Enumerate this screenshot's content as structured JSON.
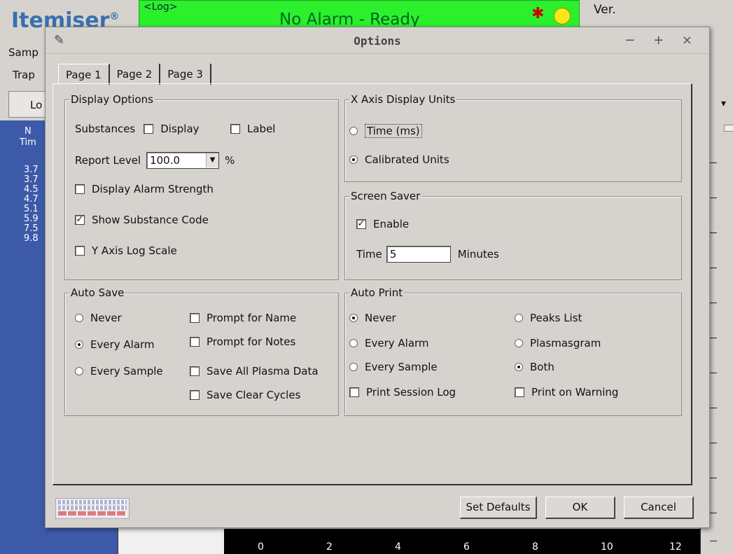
{
  "app": {
    "logo": "Itemiser",
    "logo_mark": "®",
    "status_log": "<Log>",
    "status_text": "No Alarm - Ready",
    "version_label": "Ver.",
    "bg_sample_label": "Samp",
    "bg_trap_label": "Trap",
    "bg_button_label": "Lo",
    "left_panel_header": "N\nTim",
    "left_panel_values": [
      "3.7",
      "3.7",
      "4.5",
      "4.7",
      "5.1",
      "5.9",
      "7.5",
      "9.8"
    ],
    "axis_ticks": [
      "0",
      "2",
      "4",
      "6",
      "8",
      "10",
      "12"
    ],
    "colors": {
      "status_bg": "#2cf02c",
      "panel_bg": "#3d5aa8",
      "logo": "#3a6fb0"
    }
  },
  "dialog": {
    "title": "Options",
    "title_buttons": "− + ×",
    "tabs": [
      {
        "label": "Page 1",
        "active": true
      },
      {
        "label": "Page 2",
        "active": false
      },
      {
        "label": "Page 3",
        "active": false
      }
    ],
    "display_options": {
      "title": "Display Options",
      "substances_label": "Substances",
      "display_label": "Display",
      "display_checked": false,
      "label_label": "Label",
      "label_checked": false,
      "report_level_label": "Report Level",
      "report_level_value": "100.0",
      "report_level_unit": "%",
      "alarm_strength_label": "Display Alarm Strength",
      "alarm_strength_checked": false,
      "substance_code_label": "Show Substance Code",
      "substance_code_checked": true,
      "y_log_label": "Y Axis Log Scale",
      "y_log_checked": false
    },
    "x_axis_units": {
      "title": "X Axis Display Units",
      "time_label": "Time (ms)",
      "time_selected": false,
      "calibrated_label": "Calibrated Units",
      "calibrated_selected": true
    },
    "screen_saver": {
      "title": "Screen Saver",
      "enable_label": "Enable",
      "enable_checked": true,
      "time_label": "Time",
      "time_value": "5",
      "minutes_label": "Minutes"
    },
    "auto_save": {
      "title": "Auto Save",
      "never_label": "Never",
      "every_alarm_label": "Every Alarm",
      "every_sample_label": "Every Sample",
      "selected": "Every Alarm",
      "prompt_name_label": "Prompt for Name",
      "prompt_notes_label": "Prompt for Notes",
      "save_plasma_label": "Save All Plasma Data",
      "save_clear_label": "Save Clear Cycles"
    },
    "auto_print": {
      "title": "Auto Print",
      "never_label": "Never",
      "every_alarm_label": "Every Alarm",
      "every_sample_label": "Every Sample",
      "print_session_label": "Print Session Log",
      "peaks_list_label": "Peaks List",
      "plasmasgram_label": "Plasmasgram",
      "both_label": "Both",
      "print_warning_label": "Print on Warning",
      "selected_left": "Never",
      "selected_right": "Both"
    },
    "buttons": {
      "set_defaults": "Set Defaults",
      "ok": "OK",
      "cancel": "Cancel"
    },
    "icons": [
      "pen-icon",
      "keyboard-icon",
      "dropdown-arrow-icon"
    ]
  }
}
